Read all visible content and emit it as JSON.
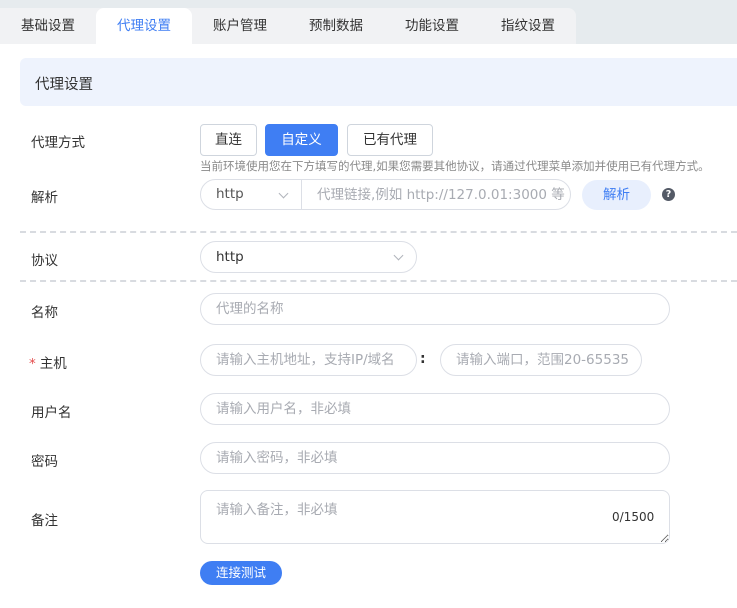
{
  "tabs": [
    {
      "label": "基础设置",
      "active": false
    },
    {
      "label": "代理设置",
      "active": true
    },
    {
      "label": "账户管理",
      "active": false
    },
    {
      "label": "预制数据",
      "active": false
    },
    {
      "label": "功能设置",
      "active": false
    },
    {
      "label": "指纹设置",
      "active": false
    }
  ],
  "section": {
    "title": "代理设置"
  },
  "proxy_mode": {
    "label": "代理方式",
    "options": [
      {
        "label": "直连",
        "selected": false
      },
      {
        "label": "自定义",
        "selected": true
      },
      {
        "label": "已有代理",
        "selected": false
      }
    ],
    "hint": "当前环境使用您在下方填写的代理,如果您需要其他协议，请通过代理菜单添加并使用已有代理方式。"
  },
  "parse": {
    "label": "解析",
    "protocol": "http",
    "placeholder": "代理链接,例如 http://127.0.01:3000 等",
    "button": "解析",
    "help_icon": "?"
  },
  "protocol": {
    "label": "协议",
    "value": "http"
  },
  "name": {
    "label": "名称",
    "placeholder": "代理的名称"
  },
  "host": {
    "required_mark": "*",
    "label": "主机",
    "host_placeholder": "请输入主机地址，支持IP/域名",
    "separator": ":",
    "port_placeholder": "请输入端口，范围20-65535"
  },
  "username": {
    "label": "用户名",
    "placeholder": "请输入用户名，非必填"
  },
  "password": {
    "label": "密码",
    "placeholder": "请输入密码，非必填"
  },
  "remark": {
    "label": "备注",
    "placeholder": "请输入备注，非必填",
    "counter": "0/1500"
  },
  "test_button": "连接测试",
  "colors": {
    "accent": "#3f7ef3",
    "accent_light": "#e8effd",
    "header_bg": "#eef3fd",
    "required": "#e34b4b"
  }
}
